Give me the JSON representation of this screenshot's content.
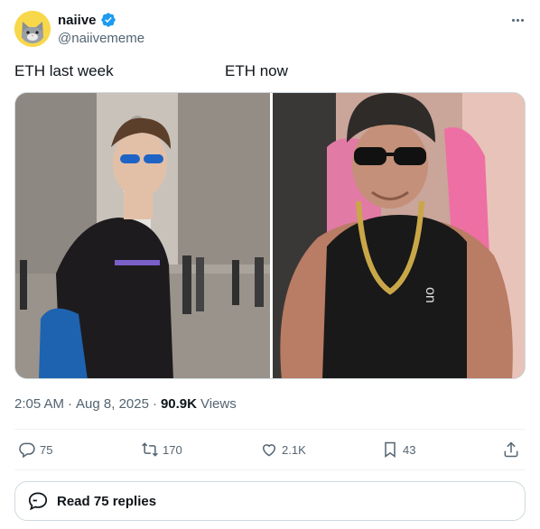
{
  "author": {
    "display_name": "naiive",
    "handle": "@naiivememe",
    "verified": true
  },
  "captions": {
    "left": "ETH last week",
    "right": "ETH now"
  },
  "meta": {
    "time": "2:05 AM",
    "dot1": "·",
    "date": "Aug 8, 2025",
    "dot2": "·",
    "views_count": "90.9K",
    "views_label": "Views"
  },
  "actions": {
    "replies": "75",
    "reposts": "170",
    "likes": "2.1K",
    "bookmarks": "43"
  },
  "read_replies_label": "Read 75 replies",
  "colors": {
    "verified": "#1d9bf0",
    "secondary_text": "#536471",
    "primary_text": "#0f1419",
    "border": "#cfd9de",
    "avatar_bg": "#f7d84a"
  },
  "icons": [
    "more-icon",
    "verified-icon",
    "reply-icon",
    "repost-icon",
    "like-icon",
    "bookmark-icon",
    "share-icon",
    "chat-bubble-icon"
  ]
}
